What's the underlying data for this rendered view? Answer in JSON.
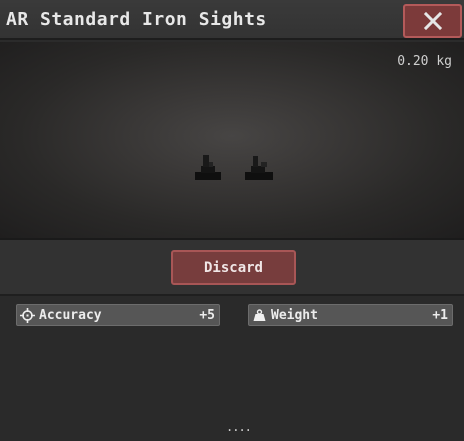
{
  "window": {
    "title": "AR Standard Iron Sights",
    "close_icon": "close-icon"
  },
  "preview": {
    "weight": "0.20 kg",
    "model_icon": "iron-sights-model"
  },
  "actions": {
    "discard_label": "Discard"
  },
  "stats": [
    {
      "icon": "crosshair-icon",
      "label": "Accuracy",
      "value": "+5"
    },
    {
      "icon": "weight-icon",
      "label": "Weight",
      "value": "+1"
    }
  ],
  "footer": {
    "more_indicator": "...."
  },
  "colors": {
    "close_button": "#7c3a3a",
    "discard_button": "#773d3d",
    "stat_bar": "#565656"
  }
}
